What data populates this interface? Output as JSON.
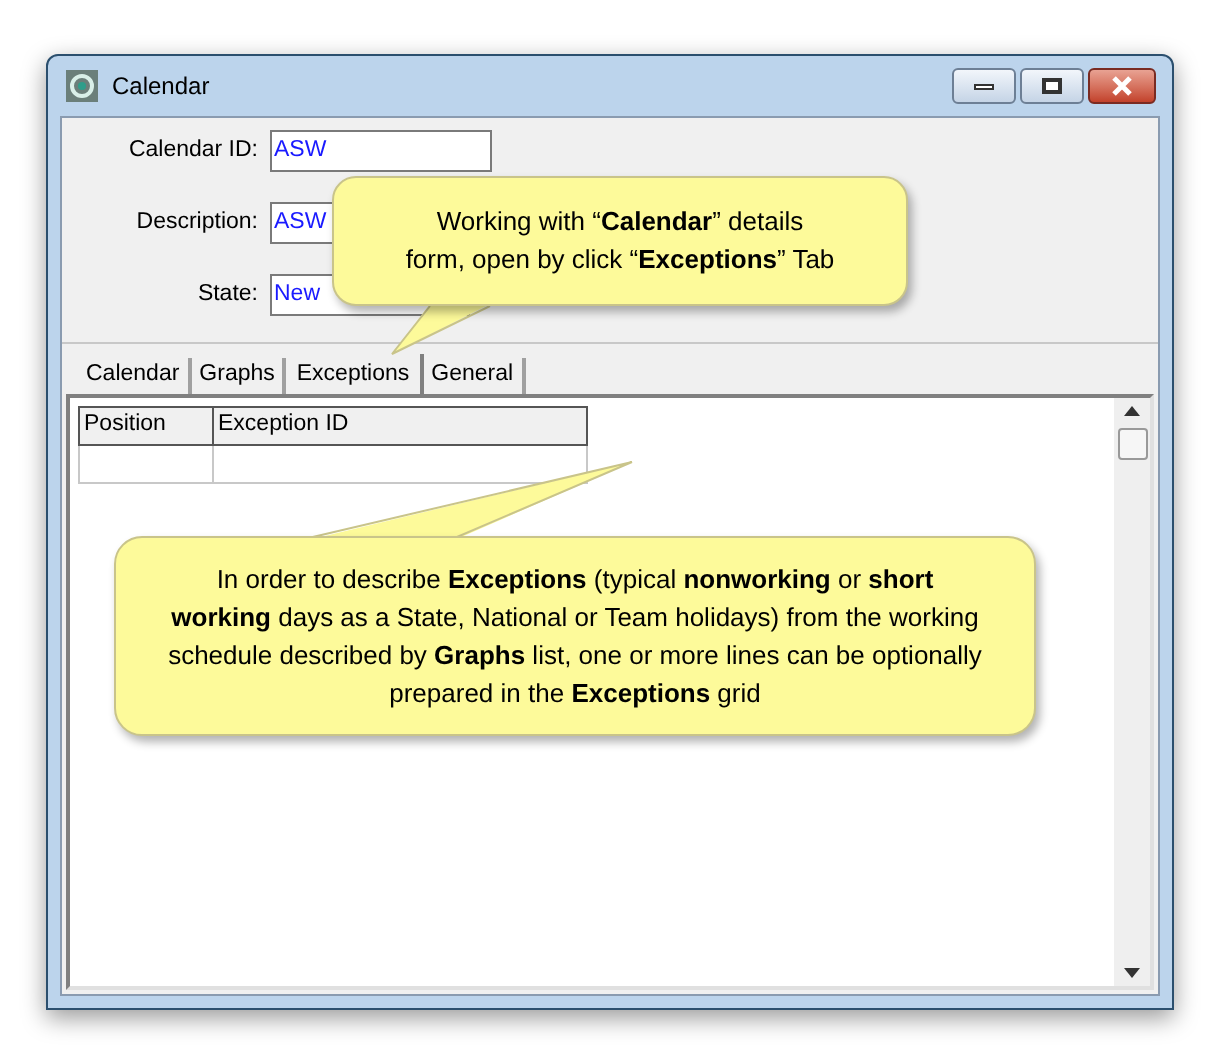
{
  "window": {
    "title": "Calendar"
  },
  "fields": [
    {
      "label": "Calendar ID:",
      "value": "ASW"
    },
    {
      "label": "Description:",
      "value": "ASW"
    },
    {
      "label": "State:",
      "value": "New"
    }
  ],
  "tabs": [
    {
      "label": "Calendar",
      "selected": false
    },
    {
      "label": "Graphs",
      "selected": false
    },
    {
      "label": "Exceptions",
      "selected": true
    },
    {
      "label": "General",
      "selected": false
    }
  ],
  "grid": {
    "columns": [
      "Position",
      "Exception ID"
    ]
  },
  "callouts": [
    "Working with “**Calendar**” details form, open by click “**Exceptions**” Tab",
    "In order to describe **Exceptions** (typical **nonworking** or **short working** days as a State, National or Team holidays) from the working schedule described by **Graphs** list, one or more lines can be optionally prepared in the **Exceptions** grid"
  ]
}
